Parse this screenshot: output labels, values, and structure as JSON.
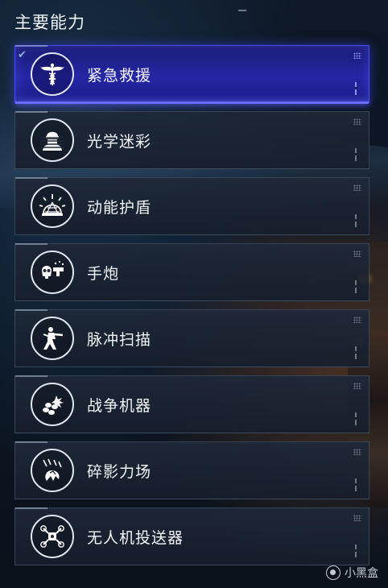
{
  "section": {
    "title": "主要能力"
  },
  "abilities": [
    {
      "label": "紧急救援",
      "icon": "medic-caduceus-icon",
      "selected": true
    },
    {
      "label": "光学迷彩",
      "icon": "optic-camo-soldier-icon",
      "selected": false
    },
    {
      "label": "动能护盾",
      "icon": "kinetic-shield-dome-icon",
      "selected": false
    },
    {
      "label": "手炮",
      "icon": "skull-hand-cannon-icon",
      "selected": false
    },
    {
      "label": "脉冲扫描",
      "icon": "running-soldier-pulse-icon",
      "selected": false
    },
    {
      "label": "战争机器",
      "icon": "war-machine-explosion-icon",
      "selected": false
    },
    {
      "label": "碎影力场",
      "icon": "shattered-field-icon",
      "selected": false
    },
    {
      "label": "无人机投送器",
      "icon": "drone-dispenser-icon",
      "selected": false
    }
  ],
  "watermark": {
    "text": "小黑盒"
  },
  "colors": {
    "selected_fill": "#2626a6",
    "selected_glow": "#4a4cff",
    "item_fill": "#1e2838"
  }
}
